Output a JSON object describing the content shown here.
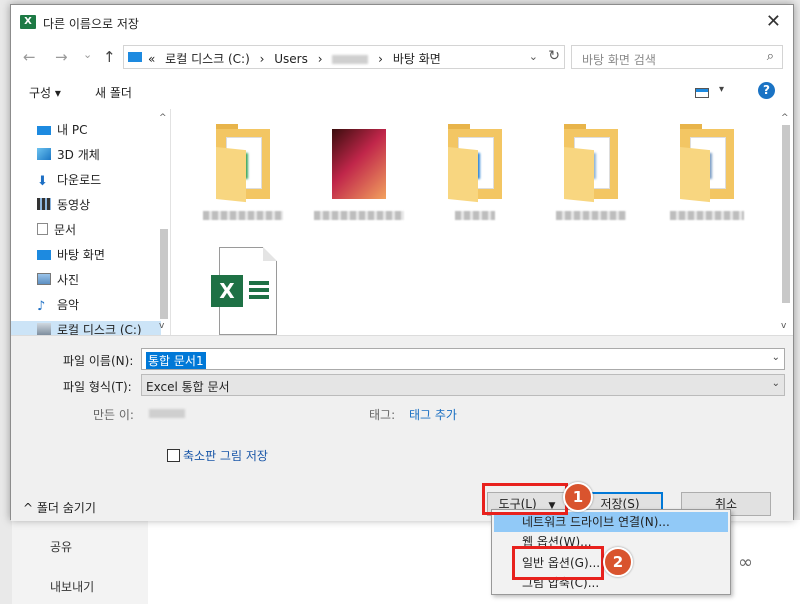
{
  "dialog": {
    "title": "다른 이름으로 저장",
    "app_icon_letter": "X",
    "close_symbol": "✕"
  },
  "address": {
    "back_symbol": "←",
    "forward_symbol": "→",
    "recent_symbol": "⌄",
    "up_symbol": "↑",
    "overflow": "«",
    "crumbs": [
      "로컬 디스크 (C:)",
      "Users",
      "바탕 화면"
    ],
    "separator": "›",
    "dropdown_symbol": "⌄",
    "refresh_symbol": "↻"
  },
  "search": {
    "placeholder": "바탕 화면 검색",
    "icon_symbol": "⌕"
  },
  "toolbar": {
    "organize": "구성 ▾",
    "new_folder": "새 폴더",
    "view_dropdown": "▾",
    "help": "?"
  },
  "nav": {
    "items": [
      {
        "label": "내 PC"
      },
      {
        "label": "3D 개체"
      },
      {
        "label": "다운로드"
      },
      {
        "label": "동영상"
      },
      {
        "label": "문서"
      },
      {
        "label": "바탕 화면"
      },
      {
        "label": "사진"
      },
      {
        "label": "음악"
      },
      {
        "label": "로컬 디스크 (C:)"
      }
    ]
  },
  "scroll": {
    "up": "▲",
    "down": "▼",
    "caret_up": "^",
    "caret_down": "v"
  },
  "form": {
    "filename_label": "파일 이름(N):",
    "filename_value": "통합 문서1",
    "filetype_label": "파일 형식(T):",
    "filetype_value": "Excel 통합 문서",
    "author_label": "만든 이:",
    "tags_label": "태그:",
    "tags_link": "태그 추가",
    "thumbnail_label": "축소판 그림 저장",
    "hide_folders": "^ 폴더 숨기기",
    "dropdown_symbol": "⌄"
  },
  "buttons": {
    "tools": "도구(L)",
    "tools_arrow": "▼",
    "save": "저장(S)",
    "cancel": "취소"
  },
  "menu": {
    "items": [
      {
        "label": "네트워크 드라이브 연결(N)...",
        "highlighted": true
      },
      {
        "label": "웹 옵션(W)..."
      },
      {
        "label": "일반 옵션(G)..."
      },
      {
        "label": "그림 압축(C)..."
      }
    ]
  },
  "annotations": {
    "step1": "1",
    "step2": "2"
  },
  "background": {
    "side_items": [
      "공유",
      "내보내기"
    ]
  },
  "colors": {
    "accent": "#0078d7",
    "annotation_red": "#e8211d",
    "badge": "#d9542e",
    "excel_green": "#1e7145",
    "folder": "#f3c663",
    "menu_highlight": "#91c9f7"
  }
}
